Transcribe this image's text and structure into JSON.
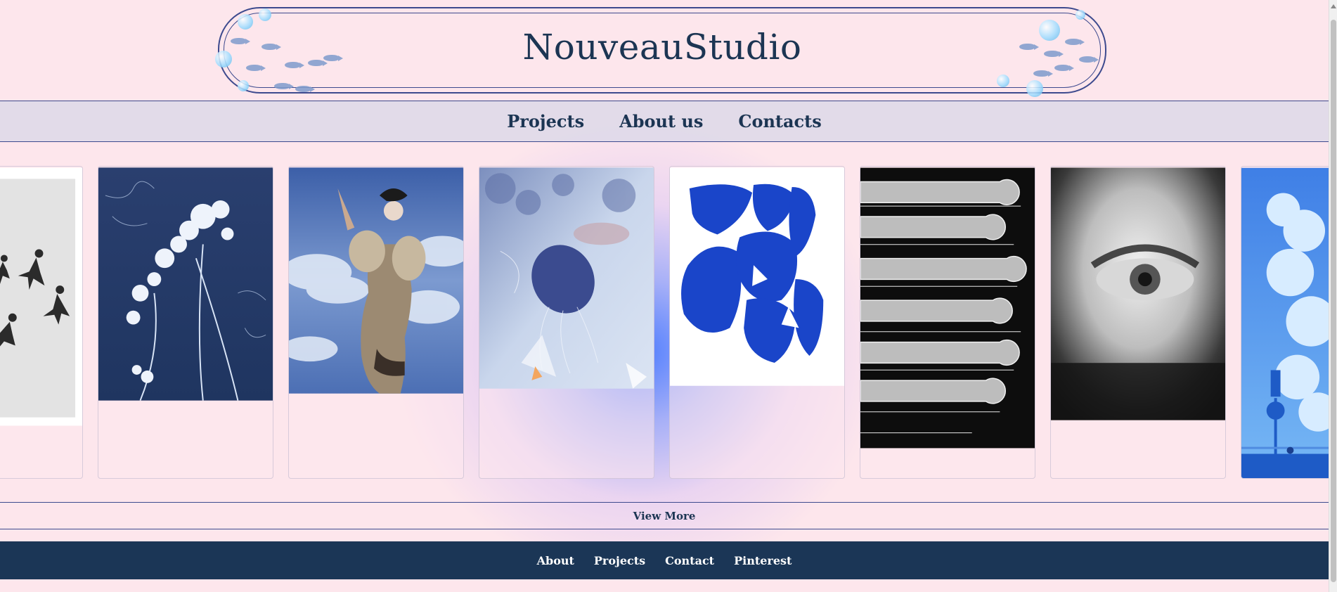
{
  "brand": {
    "title": "NouveauStudio"
  },
  "nav": {
    "items": [
      {
        "label": "Projects"
      },
      {
        "label": "About us"
      },
      {
        "label": "Contacts"
      }
    ]
  },
  "gallery": {
    "cards": [
      {
        "subject": "silhouettes of dancing figures on grey"
      },
      {
        "subject": "cyanotype of white flower umbels on blue"
      },
      {
        "subject": "woman in puff-sleeve dress against blue sky"
      },
      {
        "subject": "jellyfish collage in pale blue"
      },
      {
        "subject": "cobalt blue cut-paper shapes on white"
      },
      {
        "subject": "black and white stacked figure outlines"
      },
      {
        "subject": "blurred black and white eye close-up"
      },
      {
        "subject": "blue sky with clouds and street sign"
      }
    ]
  },
  "view_more": {
    "label": "View More"
  },
  "footer": {
    "links": [
      {
        "label": "About"
      },
      {
        "label": "Projects"
      },
      {
        "label": "Contact"
      },
      {
        "label": "Pinterest"
      }
    ]
  },
  "colors": {
    "background": "#fde6ec",
    "navy": "#1c3553",
    "frame": "#3d4a8e",
    "footer": "#1b3656",
    "accent_blue": "#1f4fd0"
  }
}
